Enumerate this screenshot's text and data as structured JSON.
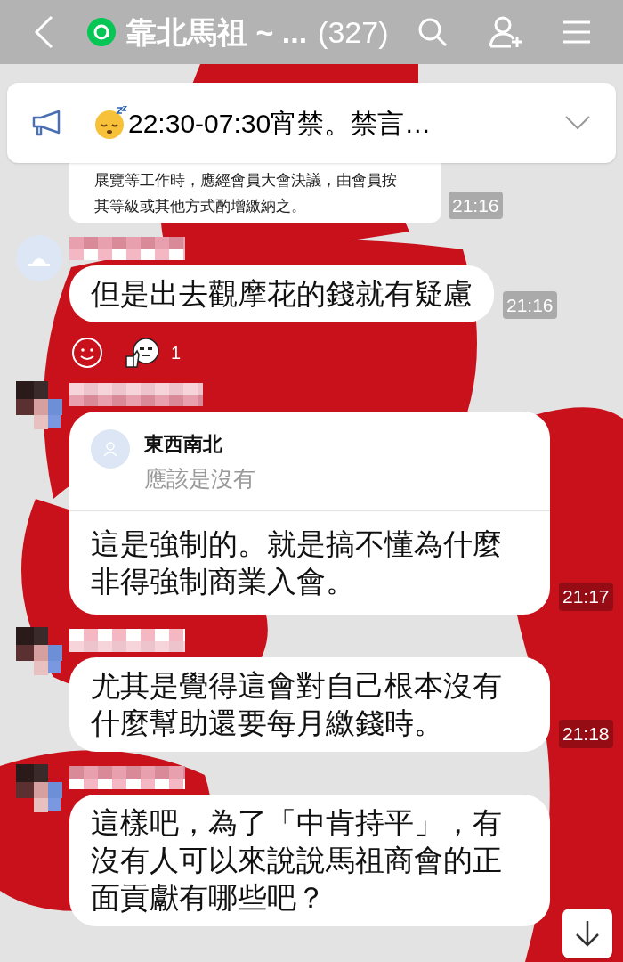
{
  "header": {
    "title": "靠北馬祖 ~ ...",
    "member_count": "(327)"
  },
  "announcement": {
    "text": "22:30-07:30宵禁。禁言…",
    "expanded": false
  },
  "messages": [
    {
      "lines": [
        "展覽等工作時，應經會員大會決議，由會員按",
        "其等級或其他方式酌增繳納之。"
      ],
      "time": "21:16"
    },
    {
      "kind": "text",
      "text": "但是出去觀摩花的錢就有疑慮",
      "time": "21:16",
      "reactions": {
        "count": "1"
      }
    },
    {
      "kind": "reply",
      "quote_name": "東西南北",
      "quote_text": "應該是沒有",
      "text": "這是強制的。就是搞不懂為什麼非得強制商業入會。",
      "time": "21:17"
    },
    {
      "kind": "text",
      "text": "尤其是覺得這會對自己根本沒有什麼幫助還要每月繳錢時。",
      "time": "21:18"
    },
    {
      "kind": "text",
      "text": "這樣吧，為了「中肯持平」，有沒有人可以來說說馬祖商會的正面貢獻有哪些吧？"
    }
  ]
}
